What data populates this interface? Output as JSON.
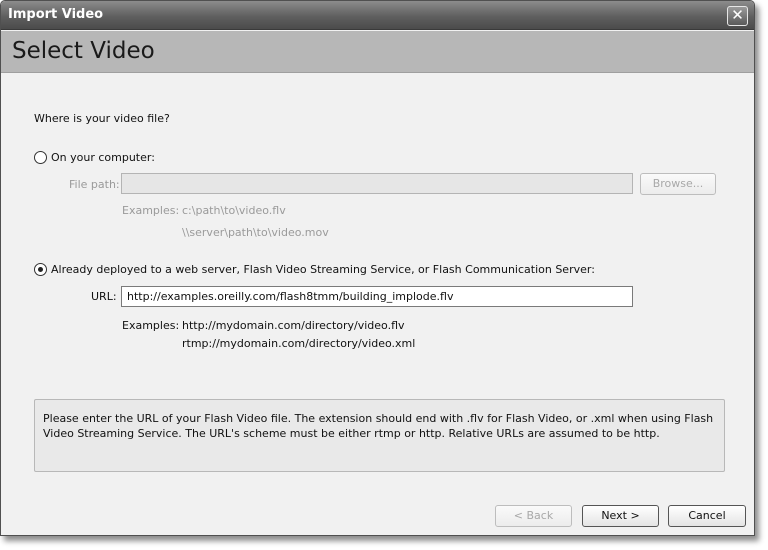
{
  "window": {
    "title": "Import Video",
    "close_glyph": "✕"
  },
  "header": {
    "title": "Select Video"
  },
  "prompt": "Where is your video file?",
  "option_computer": {
    "label": "On your computer:",
    "file_path_label": "File path:",
    "file_path_value": "",
    "browse_label": "Browse...",
    "examples_label": "Examples:",
    "example_1": "c:\\path\\to\\video.flv",
    "example_2": "\\\\server\\path\\to\\video.mov"
  },
  "option_server": {
    "label": "Already deployed to a web server, Flash Video Streaming Service, or Flash Communication Server:",
    "url_label": "URL:",
    "url_value": "http://examples.oreilly.com/flash8tmm/building_implode.flv",
    "examples_label": "Examples:",
    "example_1": "http://mydomain.com/directory/video.flv",
    "example_2": "rtmp://mydomain.com/directory/video.xml"
  },
  "selected_option": "server",
  "info_text": "Please enter the URL of your Flash Video file.  The extension should end with .flv for Flash Video, or .xml when using Flash Video Streaming Service.  The URL's scheme must be either rtmp or http.  Relative URLs are assumed to be http.",
  "buttons": {
    "back": "< Back",
    "next": "Next >",
    "cancel": "Cancel"
  }
}
